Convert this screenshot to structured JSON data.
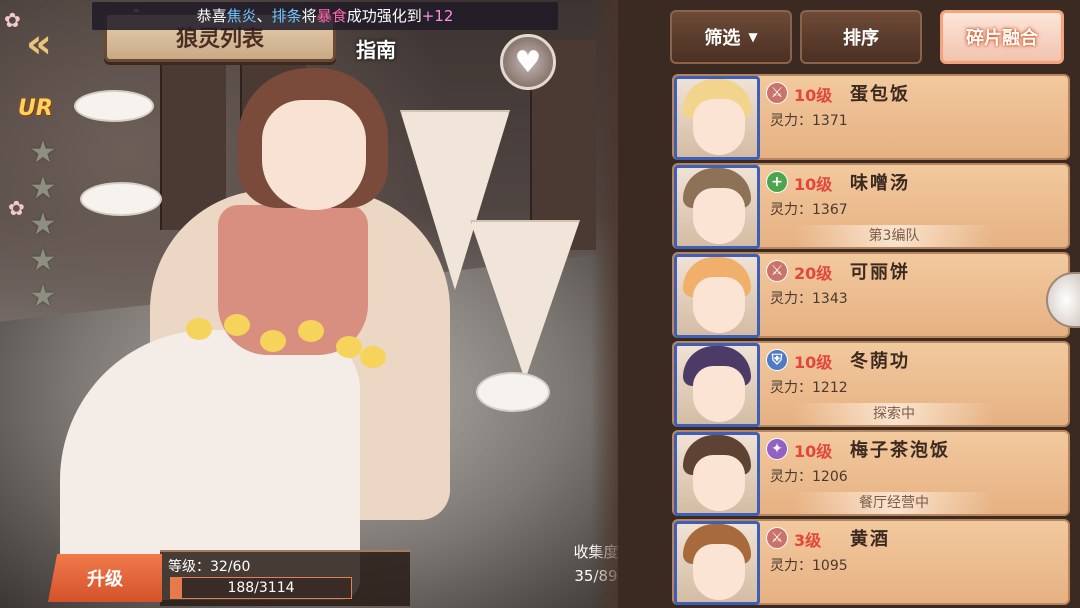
{
  "banner": {
    "p1": "恭喜",
    "name1": "焦炎",
    "sep": "、",
    "name2": "排条",
    "p2": "将",
    "item": "暴食",
    "p3": "成功强化到",
    "bonus": "+12"
  },
  "header": {
    "title": "狼灵列表",
    "guide": "指南",
    "back_icon": "back-arrow-icon",
    "heart_icon": "heart-icon"
  },
  "hero": {
    "rarity": "UR",
    "stars_total": 5,
    "stars_filled": 0,
    "level_label": "等级：32/60",
    "exp_current": 188,
    "exp_max": 3114,
    "exp_text": "188/3114",
    "upgrade_label": "升级"
  },
  "collection": {
    "label": "收集度",
    "value": "35/89"
  },
  "toolbar": {
    "filter": "筛选",
    "sort": "排序",
    "fuse": "碎片融合"
  },
  "list": [
    {
      "icon": "sword-icon",
      "icon_color": "#c9736a",
      "level": "10级",
      "name": "蛋包饭",
      "power": "灵力：1371",
      "status": "",
      "hair": "#f3d48c"
    },
    {
      "icon": "heal-plus-icon",
      "icon_color": "#4da64d",
      "level": "10级",
      "name": "味噌汤",
      "power": "灵力：1367",
      "status": "第3编队",
      "hair": "#8d7258"
    },
    {
      "icon": "sword-icon",
      "icon_color": "#c9736a",
      "level": "20级",
      "name": "可丽饼",
      "power": "灵力：1343",
      "status": "",
      "hair": "#f0b06c"
    },
    {
      "icon": "shield-icon",
      "icon_color": "#4f7ac4",
      "level": "10级",
      "name": "冬荫功",
      "power": "灵力：1212",
      "status": "探索中",
      "hair": "#4c3b66"
    },
    {
      "icon": "star-magic-icon",
      "icon_color": "#9360c4",
      "level": "10级",
      "name": "梅子茶泡饭",
      "power": "灵力：1206",
      "status": "餐厅经营中",
      "hair": "#5e4234"
    },
    {
      "icon": "sword-icon",
      "icon_color": "#c9736a",
      "level": "3级",
      "name": "黄酒",
      "power": "灵力：1095",
      "status": "",
      "hair": "#a66a3c"
    }
  ]
}
